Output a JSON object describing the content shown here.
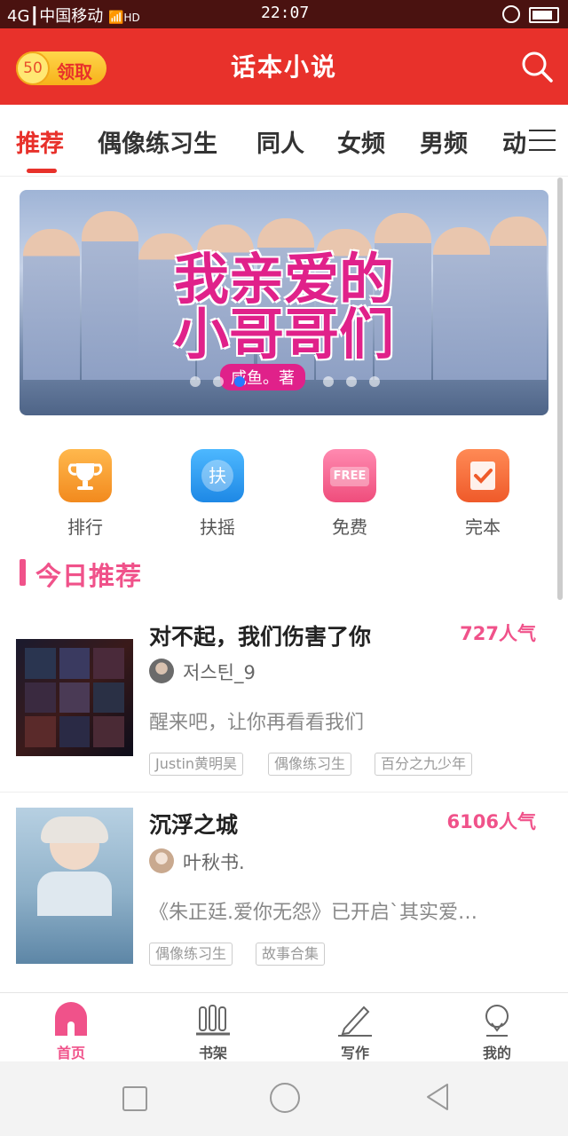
{
  "status_bar": {
    "signal_text": "4G┃中国移动",
    "wifi_hd": "HD",
    "time": "22:07"
  },
  "header": {
    "coin_amount": "50",
    "claim_label": "领取",
    "title": "话本小说"
  },
  "tabs": [
    "推荐",
    "偶像练习生",
    "同人",
    "女频",
    "男频",
    "动"
  ],
  "banner": {
    "title_line1": "我亲爱的",
    "title_line2": "小哥哥们",
    "author_tag": "咸鱼。著"
  },
  "quick_links": [
    {
      "label": "排行",
      "icon": "trophy-icon",
      "color": "#f7a13a"
    },
    {
      "label": "扶摇",
      "icon": "boost-icon",
      "color": "#2f9cf0",
      "glyph": "扶"
    },
    {
      "label": "免费",
      "icon": "free-tag-icon",
      "color": "#f25a8a",
      "glyph": "FREE"
    },
    {
      "label": "完本",
      "icon": "check-book-icon",
      "color": "#f26a3a"
    }
  ],
  "section": {
    "title": "今日推荐"
  },
  "books": [
    {
      "title": "对不起，我们伤害了你",
      "popularity": "727人气",
      "author": "저스틴_9",
      "description": "醒来吧，让你再看看我们",
      "tags": [
        "Justin黄明昊",
        "偶像练习生",
        "百分之九少年"
      ]
    },
    {
      "title": "沉浮之城",
      "popularity": "6106人气",
      "author": "叶秋书.",
      "description": "《朱正廷.爱你无怨》已开启ˋ其实爱…",
      "tags": [
        "偶像练习生",
        "故事合集"
      ]
    }
  ],
  "bottom_nav": [
    {
      "label": "首页",
      "icon": "home-icon",
      "active": true
    },
    {
      "label": "书架",
      "icon": "bookshelf-icon",
      "active": false
    },
    {
      "label": "写作",
      "icon": "pencil-icon",
      "active": false
    },
    {
      "label": "我的",
      "icon": "profile-icon",
      "active": false
    }
  ],
  "colors": {
    "brand_red": "#e8312b",
    "accent_pink": "#f0528a",
    "coin_yellow": "#f6b21a"
  }
}
